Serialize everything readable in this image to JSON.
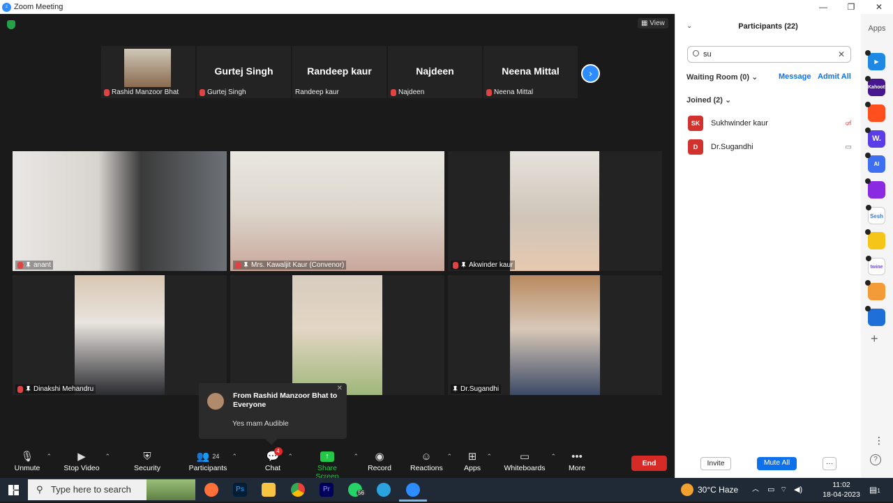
{
  "window": {
    "title": "Zoom Meeting",
    "controls": [
      "—",
      "❐",
      "✕"
    ]
  },
  "meeting": {
    "view_label": "View",
    "strip": [
      {
        "name": "Rashid Manzoor Bhat",
        "big": "",
        "has_photo": true
      },
      {
        "name": "Gurtej Singh",
        "big": "Gurtej Singh"
      },
      {
        "name": "Randeep kaur",
        "big": "Randeep kaur"
      },
      {
        "name": "Najdeen",
        "big": "Najdeen"
      },
      {
        "name": "Neena Mittal",
        "big": "Neena Mittal"
      }
    ],
    "tiles": [
      {
        "name": "anant"
      },
      {
        "name": "Mrs. Kawaljit Kaur (Convenor)"
      },
      {
        "name": "Akwinder kaur"
      },
      {
        "name": "Dinakshi Mehandru"
      },
      {
        "name": ""
      },
      {
        "name": "Dr.Sugandhi"
      }
    ],
    "chat_toast": {
      "from": "From Rashid Manzoor Bhat to Everyone",
      "message": "Yes mam Audible"
    }
  },
  "toolbar": {
    "unmute": "Unmute",
    "stop_video": "Stop Video",
    "security": "Security",
    "participants": "Participants",
    "participants_count": "24",
    "chat": "Chat",
    "chat_badge": "4",
    "share_screen": "Share Screen",
    "record": "Record",
    "reactions": "Reactions",
    "apps": "Apps",
    "whiteboards": "Whiteboards",
    "more": "More",
    "end": "End"
  },
  "participants_panel": {
    "title": "Participants (22)",
    "search_value": "su",
    "waiting_room": "Waiting Room (0)",
    "message_link": "Message",
    "admit_all_link": "Admit All",
    "joined": "Joined (2)",
    "people": [
      {
        "initials": "SK",
        "name": "Sukhwinder kaur"
      },
      {
        "initials": "D",
        "name": "Dr.Sugandhi"
      }
    ],
    "invite": "Invite",
    "mute_all": "Mute All",
    "more": "···"
  },
  "apps_sidebar": {
    "title": "Apps",
    "icons": [
      {
        "label": "",
        "color": "#1e88e5"
      },
      {
        "label": "Kahoot!",
        "color": "#46178f"
      },
      {
        "label": "",
        "color": "#ff4f1f"
      },
      {
        "label": "W.",
        "color": "#5b3de8"
      },
      {
        "label": "AI",
        "color": "#3d6ff0"
      },
      {
        "label": "",
        "color": "#8a2be2"
      },
      {
        "label": "Sesh",
        "color": "#3a7bd5"
      },
      {
        "label": "",
        "color": "#f5c518"
      },
      {
        "label": "twine",
        "color": "#6a4cff"
      },
      {
        "label": "",
        "color": "#f29b38"
      },
      {
        "label": "",
        "color": "#1e6fd8"
      }
    ]
  },
  "taskbar": {
    "search_placeholder": "Type here to search",
    "whatsapp_badge": "56",
    "weather": "30°C  Haze",
    "time": "11:02",
    "date": "18-04-2023",
    "notifications": "1"
  }
}
